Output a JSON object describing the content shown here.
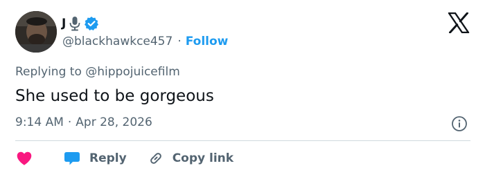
{
  "user": {
    "display_name": "J",
    "handle": "@blackhawkce457",
    "follow_label": "Follow"
  },
  "replying": {
    "prefix": "Replying to",
    "mention": "@hippojuicefilm"
  },
  "tweet": {
    "text": "She used to be gorgeous",
    "time": "9:14 AM",
    "date": "Apr 28, 2026"
  },
  "actions": {
    "reply_label": "Reply",
    "copy_label": "Copy link"
  },
  "colors": {
    "accent": "#1d9bf0",
    "like": "#f91880",
    "text": "#0f1419",
    "secondary": "#536471",
    "divider": "#cfd9de"
  },
  "icons": [
    "microphone-icon",
    "verified-badge-icon",
    "x-logo-icon",
    "info-icon",
    "heart-icon",
    "reply-bubble-icon",
    "link-icon"
  ]
}
